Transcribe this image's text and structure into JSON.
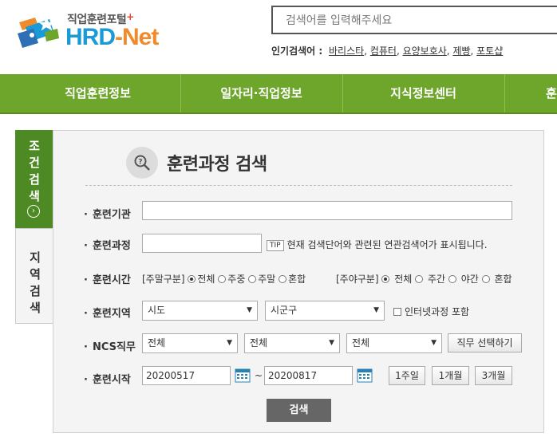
{
  "logo": {
    "small": "직업훈련포털",
    "plus": "+",
    "hrd": "HRD",
    "dash": "-",
    "net": "Net"
  },
  "search": {
    "placeholder": "검색어를 입력해주세요"
  },
  "popular": {
    "label": "인기검색어 :",
    "terms": [
      "바리스타",
      "컴퓨터",
      "요양보호사",
      "제빵",
      "포토샵"
    ]
  },
  "nav": [
    "직업훈련정보",
    "일자리·직업정보",
    "지식정보센터",
    "훈"
  ],
  "side_tabs": {
    "active": [
      "조",
      "건",
      "검",
      "색"
    ],
    "inactive": [
      "지",
      "역",
      "검",
      "색"
    ]
  },
  "page_title": "훈련과정 검색",
  "form": {
    "institution_label": "훈련기관",
    "course_label": "훈련과정",
    "tip_badge": "TIP",
    "tip_text": "현재 검색단어와 관련된 연관검색어가 표시됩니다.",
    "time_label": "훈련시간",
    "weekend_group": "[주말구분]",
    "weekend_options": [
      "전체",
      "주중",
      "주말",
      "혼합"
    ],
    "daynight_group": "[주야구분]",
    "daynight_options": [
      "전체",
      "주간",
      "야간",
      "혼합"
    ],
    "region_label": "훈련지역",
    "region_sido": "시도",
    "region_sigungu": "시군구",
    "online_checkbox": "인터넷과정 포함",
    "ncs_label": "NCS직무",
    "ncs_1": "전체",
    "ncs_2": "전체",
    "ncs_3": "전체",
    "ncs_button": "직무 선택하기",
    "start_label": "훈련시작",
    "start_from": "20200517",
    "tilde": "~",
    "start_to": "20200817",
    "period_buttons": [
      "1주일",
      "1개월",
      "3개월"
    ],
    "submit": "검색"
  },
  "colors": {
    "nav_green": "#6ea52b",
    "tab_green": "#4e8a23",
    "logo_blue": "#1a9ad6",
    "logo_orange": "#f08a2a"
  }
}
